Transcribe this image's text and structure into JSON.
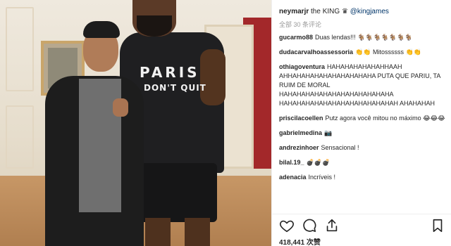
{
  "post": {
    "author": "neymarjr",
    "caption": "the KING",
    "mention": "@kingjames",
    "comments_count_label": "全部 30 条评论",
    "likes_label": "418,441 次赞",
    "shirt_line1": "PARIS",
    "shirt_line2": "DON'T QUIT"
  },
  "comments": [
    {
      "user": "gucarmo88",
      "text": "Duas lendas!!! 🐐🐐🐐🐐🐐🐐🐐"
    },
    {
      "user": "dudacarvalhoassessoria",
      "text": "👏👏 Mitossssss 👏👏"
    },
    {
      "user": "othiagoventura",
      "text": "HAHAHAHAHAHAHHAAH AHHAHAHAHAHAHAHAHAHAHA PUTA QUE PARIU, TA RUIM DE MORAL HAHAHAHAHAHAHAHAHAHAHAHAHA HAHAHAHAHAHAHAHAHAHAHAHAHAH AHAHAHAH"
    },
    {
      "user": "priscilacoellen",
      "text": "Putz agora você mitou no máximo 😂😂😂"
    },
    {
      "user": "gabrielmedina",
      "text": "📷"
    },
    {
      "user": "andrezinhoer",
      "text": "Sensacional !"
    },
    {
      "user": "bilal.19_",
      "text": "💣💣💣"
    },
    {
      "user": "adenacia",
      "text": "Incríveis !"
    }
  ],
  "actions": {
    "icons": [
      "heart-icon",
      "comment-icon",
      "share-icon",
      "bookmark-icon"
    ]
  },
  "colors": {
    "link": "#003569",
    "text": "#262626",
    "muted": "#999999",
    "border": "#efefef"
  }
}
